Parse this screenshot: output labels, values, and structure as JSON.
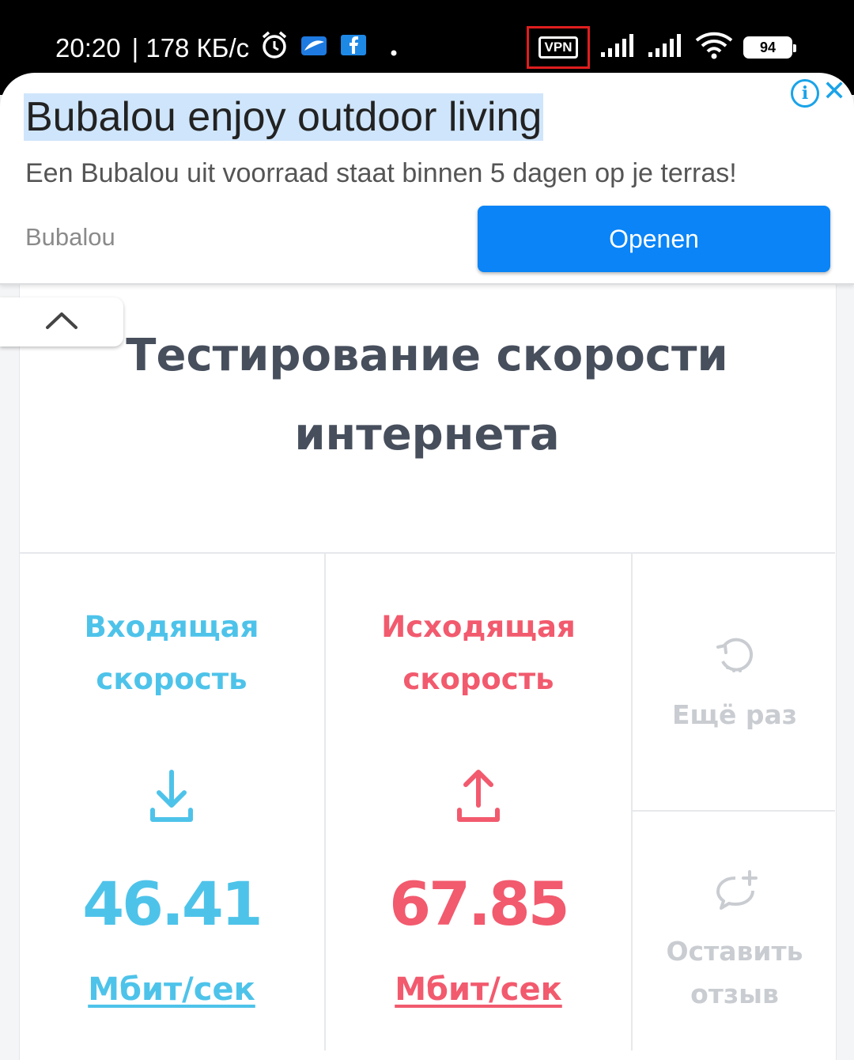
{
  "status_bar": {
    "time": "20:20",
    "speed": "| 178 КБ/с",
    "vpn_label": "VPN",
    "battery": "94",
    "icons": [
      "alarm-icon",
      "app-icon",
      "facebook-icon",
      "dot-icon",
      "signal-icon",
      "wifi-icon",
      "battery-icon"
    ]
  },
  "ad": {
    "title": "Bubalou enjoy outdoor living",
    "description": "Een Bubalou uit voorraad staat binnen 5 dagen op je terras!",
    "brand": "Bubalou",
    "open_label": "Openen"
  },
  "page": {
    "title_line1": "Тестирование скорости",
    "title_line2": "интернета"
  },
  "download": {
    "label_line1": "Входящая",
    "label_line2": "скорость",
    "value": "46.41",
    "unit": "Мбит/сек",
    "color": "#4ec3ea"
  },
  "upload": {
    "label_line1": "Исходящая",
    "label_line2": "скорость",
    "value": "67.85",
    "unit": "Мбит/сек",
    "color": "#f25a6e"
  },
  "actions": {
    "retry_label": "Ещё раз",
    "feedback_line1": "Оставить",
    "feedback_line2": "отзыв"
  }
}
